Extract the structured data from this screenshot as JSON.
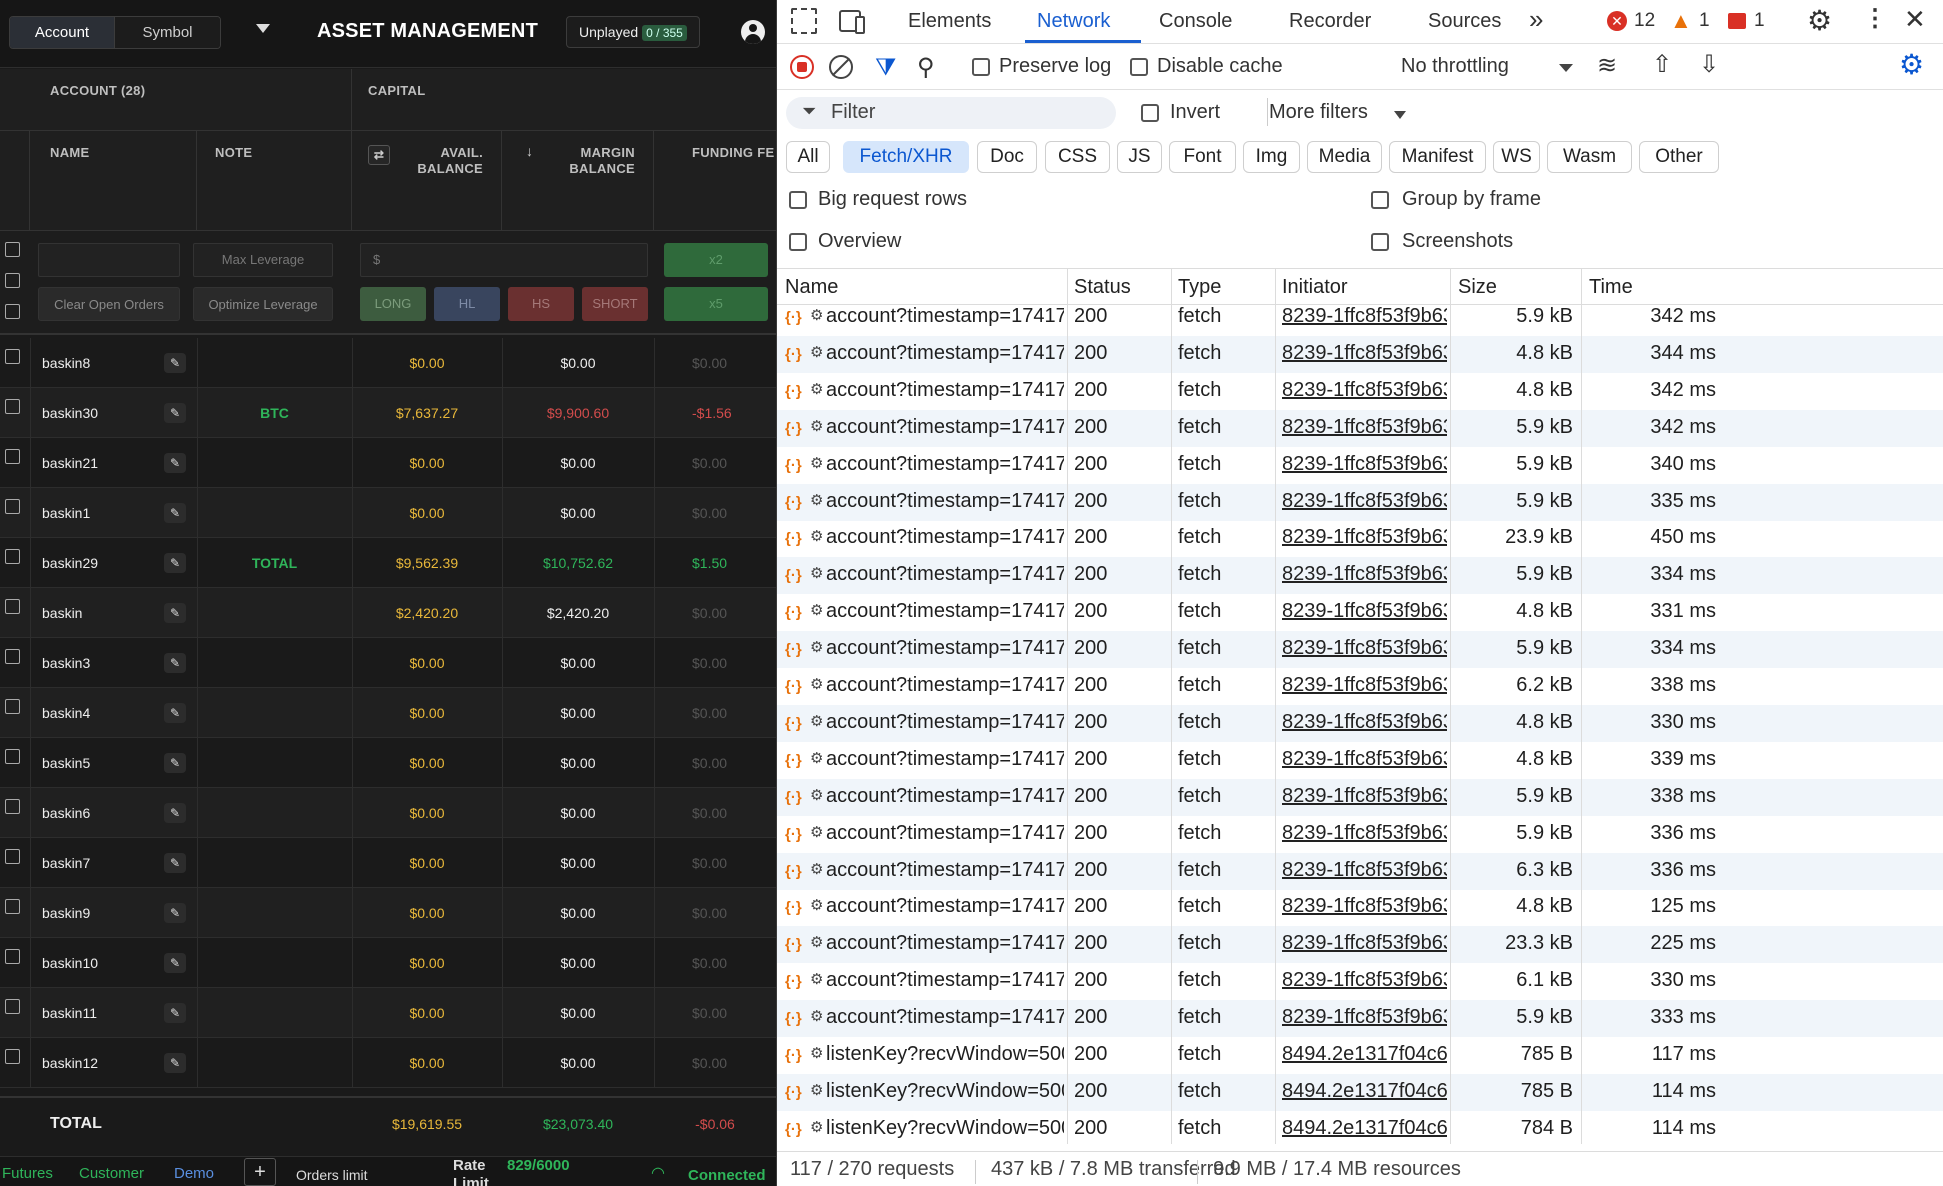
{
  "app": {
    "seg_account": "Account",
    "seg_symbol": "Symbol",
    "title": "ASSET MANAGEMENT",
    "unplayed_label": "Unplayed",
    "unplayed_count": "0 / 355",
    "account_group": "ACCOUNT (28)",
    "capital_group": "CAPITAL",
    "col_name": "NAME",
    "col_note": "NOTE",
    "col_avail": "AVAIL.\nBALANCE",
    "col_margin": "MARGIN\nBALANCE",
    "col_funding": "FUNDING FE",
    "max_leverage": "Max Leverage",
    "clear_orders": "Clear Open Orders",
    "optimize_leverage": "Optimize Leverage",
    "dollar_placeholder": "$",
    "btn_long": "LONG",
    "btn_hl": "HL",
    "btn_hs": "HS",
    "btn_short": "SHORT",
    "btn_x2": "x2",
    "btn_x5": "x5",
    "total_label": "TOTAL",
    "total_avail": "$19,619.55",
    "total_margin": "$23,073.40",
    "total_funding": "-$0.06",
    "footer": {
      "futures": "Futures",
      "customer": "Customer",
      "demo": "Demo",
      "plus": "+",
      "orders_limit": "Orders limit",
      "rate": "Rate",
      "rate_value": "829/6000",
      "limit": "Limit",
      "connected": "Connected"
    },
    "rows": [
      {
        "name": "baskin8",
        "note": "",
        "avail": "$0.00",
        "margin": "$0.00",
        "funding": "$0.00",
        "ac": "yellow",
        "mc": "white",
        "fc": "dim"
      },
      {
        "name": "baskin30",
        "note": "BTC",
        "avail": "$7,637.27",
        "margin": "$9,900.60",
        "funding": "-$1.56",
        "ac": "yellow",
        "mc": "red",
        "fc": "red"
      },
      {
        "name": "baskin21",
        "note": "",
        "avail": "$0.00",
        "margin": "$0.00",
        "funding": "$0.00",
        "ac": "yellow",
        "mc": "white",
        "fc": "dim"
      },
      {
        "name": "baskin1",
        "note": "",
        "avail": "$0.00",
        "margin": "$0.00",
        "funding": "$0.00",
        "ac": "yellow",
        "mc": "white",
        "fc": "dim"
      },
      {
        "name": "baskin29",
        "note": "TOTAL",
        "avail": "$9,562.39",
        "margin": "$10,752.62",
        "funding": "$1.50",
        "ac": "yellow",
        "mc": "green",
        "fc": "green"
      },
      {
        "name": "baskin",
        "note": "",
        "avail": "$2,420.20",
        "margin": "$2,420.20",
        "funding": "$0.00",
        "ac": "yellow",
        "mc": "white",
        "fc": "dim"
      },
      {
        "name": "baskin3",
        "note": "",
        "avail": "$0.00",
        "margin": "$0.00",
        "funding": "$0.00",
        "ac": "yellow",
        "mc": "white",
        "fc": "dim"
      },
      {
        "name": "baskin4",
        "note": "",
        "avail": "$0.00",
        "margin": "$0.00",
        "funding": "$0.00",
        "ac": "yellow",
        "mc": "white",
        "fc": "dim"
      },
      {
        "name": "baskin5",
        "note": "",
        "avail": "$0.00",
        "margin": "$0.00",
        "funding": "$0.00",
        "ac": "yellow",
        "mc": "white",
        "fc": "dim"
      },
      {
        "name": "baskin6",
        "note": "",
        "avail": "$0.00",
        "margin": "$0.00",
        "funding": "$0.00",
        "ac": "yellow",
        "mc": "white",
        "fc": "dim"
      },
      {
        "name": "baskin7",
        "note": "",
        "avail": "$0.00",
        "margin": "$0.00",
        "funding": "$0.00",
        "ac": "yellow",
        "mc": "white",
        "fc": "dim"
      },
      {
        "name": "baskin9",
        "note": "",
        "avail": "$0.00",
        "margin": "$0.00",
        "funding": "$0.00",
        "ac": "yellow",
        "mc": "white",
        "fc": "dim"
      },
      {
        "name": "baskin10",
        "note": "",
        "avail": "$0.00",
        "margin": "$0.00",
        "funding": "$0.00",
        "ac": "yellow",
        "mc": "white",
        "fc": "dim"
      },
      {
        "name": "baskin11",
        "note": "",
        "avail": "$0.00",
        "margin": "$0.00",
        "funding": "$0.00",
        "ac": "yellow",
        "mc": "white",
        "fc": "dim"
      },
      {
        "name": "baskin12",
        "note": "",
        "avail": "$0.00",
        "margin": "$0.00",
        "funding": "$0.00",
        "ac": "yellow",
        "mc": "white",
        "fc": "dim"
      }
    ]
  },
  "devtools": {
    "tabs": [
      "Elements",
      "Network",
      "Console",
      "Recorder",
      "Sources"
    ],
    "more_tabs": "»",
    "errors": "12",
    "warnings": "1",
    "issues": "1",
    "preserve_log": "Preserve log",
    "disable_cache": "Disable cache",
    "throttling": "No throttling",
    "filter_placeholder": "Filter",
    "invert": "Invert",
    "more_filters": "More filters",
    "types": [
      "All",
      "Fetch/XHR",
      "Doc",
      "CSS",
      "JS",
      "Font",
      "Img",
      "Media",
      "Manifest",
      "WS",
      "Wasm",
      "Other"
    ],
    "big_rows": "Big request rows",
    "group_by_frame": "Group by frame",
    "overview": "Overview",
    "screenshots": "Screenshots",
    "columns": [
      "Name",
      "Status",
      "Type",
      "Initiator",
      "Size",
      "Time"
    ],
    "requests": [
      {
        "name": "account?timestamp=17417...",
        "status": "200",
        "type": "fetch",
        "init": "8239-1ffc8f53f9b63:",
        "size": "5.9 kB",
        "time": "342 ms"
      },
      {
        "name": "account?timestamp=17417...",
        "status": "200",
        "type": "fetch",
        "init": "8239-1ffc8f53f9b63:",
        "size": "4.8 kB",
        "time": "344 ms"
      },
      {
        "name": "account?timestamp=17417...",
        "status": "200",
        "type": "fetch",
        "init": "8239-1ffc8f53f9b63:",
        "size": "4.8 kB",
        "time": "342 ms"
      },
      {
        "name": "account?timestamp=17417...",
        "status": "200",
        "type": "fetch",
        "init": "8239-1ffc8f53f9b63:",
        "size": "5.9 kB",
        "time": "342 ms"
      },
      {
        "name": "account?timestamp=17417...",
        "status": "200",
        "type": "fetch",
        "init": "8239-1ffc8f53f9b63:",
        "size": "5.9 kB",
        "time": "340 ms"
      },
      {
        "name": "account?timestamp=17417...",
        "status": "200",
        "type": "fetch",
        "init": "8239-1ffc8f53f9b63:",
        "size": "5.9 kB",
        "time": "335 ms"
      },
      {
        "name": "account?timestamp=17417...",
        "status": "200",
        "type": "fetch",
        "init": "8239-1ffc8f53f9b63:",
        "size": "23.9 kB",
        "time": "450 ms"
      },
      {
        "name": "account?timestamp=17417...",
        "status": "200",
        "type": "fetch",
        "init": "8239-1ffc8f53f9b63:",
        "size": "5.9 kB",
        "time": "334 ms"
      },
      {
        "name": "account?timestamp=17417...",
        "status": "200",
        "type": "fetch",
        "init": "8239-1ffc8f53f9b63:",
        "size": "4.8 kB",
        "time": "331 ms"
      },
      {
        "name": "account?timestamp=17417...",
        "status": "200",
        "type": "fetch",
        "init": "8239-1ffc8f53f9b63:",
        "size": "5.9 kB",
        "time": "334 ms"
      },
      {
        "name": "account?timestamp=17417...",
        "status": "200",
        "type": "fetch",
        "init": "8239-1ffc8f53f9b63:",
        "size": "6.2 kB",
        "time": "338 ms"
      },
      {
        "name": "account?timestamp=17417...",
        "status": "200",
        "type": "fetch",
        "init": "8239-1ffc8f53f9b63:",
        "size": "4.8 kB",
        "time": "330 ms"
      },
      {
        "name": "account?timestamp=17417...",
        "status": "200",
        "type": "fetch",
        "init": "8239-1ffc8f53f9b63:",
        "size": "4.8 kB",
        "time": "339 ms"
      },
      {
        "name": "account?timestamp=17417...",
        "status": "200",
        "type": "fetch",
        "init": "8239-1ffc8f53f9b63:",
        "size": "5.9 kB",
        "time": "338 ms"
      },
      {
        "name": "account?timestamp=17417...",
        "status": "200",
        "type": "fetch",
        "init": "8239-1ffc8f53f9b63:",
        "size": "5.9 kB",
        "time": "336 ms"
      },
      {
        "name": "account?timestamp=17417...",
        "status": "200",
        "type": "fetch",
        "init": "8239-1ffc8f53f9b63:",
        "size": "6.3 kB",
        "time": "336 ms"
      },
      {
        "name": "account?timestamp=17417...",
        "status": "200",
        "type": "fetch",
        "init": "8239-1ffc8f53f9b63:",
        "size": "4.8 kB",
        "time": "125 ms"
      },
      {
        "name": "account?timestamp=17417...",
        "status": "200",
        "type": "fetch",
        "init": "8239-1ffc8f53f9b63:",
        "size": "23.3 kB",
        "time": "225 ms"
      },
      {
        "name": "account?timestamp=17417...",
        "status": "200",
        "type": "fetch",
        "init": "8239-1ffc8f53f9b63:",
        "size": "6.1 kB",
        "time": "330 ms"
      },
      {
        "name": "account?timestamp=17417...",
        "status": "200",
        "type": "fetch",
        "init": "8239-1ffc8f53f9b63:",
        "size": "5.9 kB",
        "time": "333 ms"
      },
      {
        "name": "listenKey?recvWindow=500...",
        "status": "200",
        "type": "fetch",
        "init": "8494.2e1317f04c605",
        "size": "785 B",
        "time": "117 ms"
      },
      {
        "name": "listenKey?recvWindow=500...",
        "status": "200",
        "type": "fetch",
        "init": "8494.2e1317f04c605",
        "size": "785 B",
        "time": "114 ms"
      },
      {
        "name": "listenKey?recvWindow=500...",
        "status": "200",
        "type": "fetch",
        "init": "8494.2e1317f04c605",
        "size": "784 B",
        "time": "114 ms"
      }
    ],
    "status_requests": "117 / 270 requests",
    "status_transferred": "437 kB / 7.8 MB transferred",
    "status_resources": "9.9 MB / 17.4 MB resources"
  }
}
